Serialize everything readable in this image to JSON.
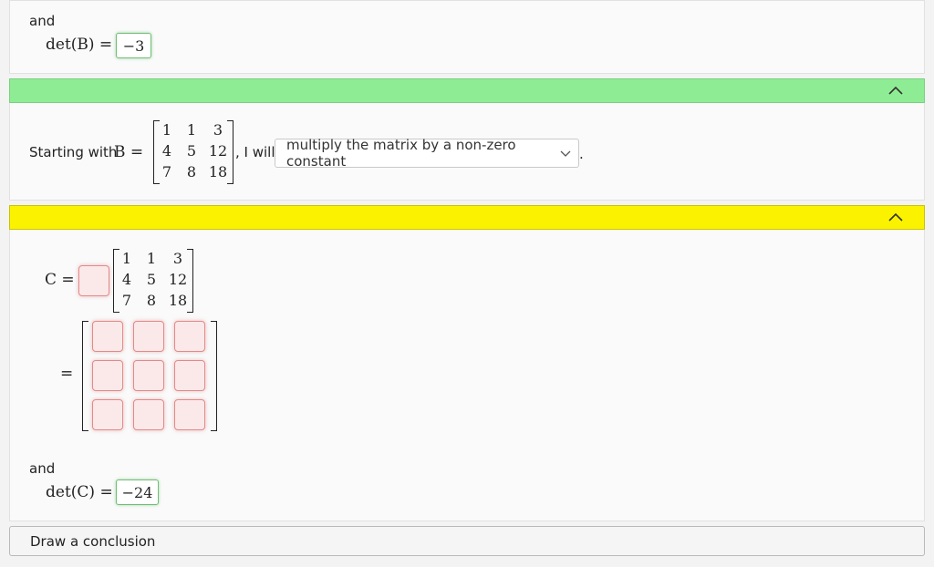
{
  "top": {
    "and_label": "and",
    "det_label": "det(B) =",
    "det_value": "−3"
  },
  "green_bar": {
    "color": "#8eed94"
  },
  "step": {
    "intro": "Starting with",
    "b_label": "B =",
    "matrix_b": [
      [
        "1",
        "1",
        "3"
      ],
      [
        "4",
        "5",
        "12"
      ],
      [
        "7",
        "8",
        "18"
      ]
    ],
    "i_will": ", I will",
    "select_value": "multiply the matrix by a non-zero constant",
    "period": "."
  },
  "yellow_bar": {
    "color": "#fbf200"
  },
  "bottom": {
    "c_label": "C =",
    "matrix": [
      [
        "1",
        "1",
        "3"
      ],
      [
        "4",
        "5",
        "12"
      ],
      [
        "7",
        "8",
        "18"
      ]
    ],
    "equals": "=",
    "and_label": "and",
    "det_label": "det(C) =",
    "det_value": "−24"
  },
  "conclusion_label": "Draw a conclusion",
  "icons": {
    "collapse": "chevron-up-icon",
    "dropdown": "chevron-down-icon"
  }
}
